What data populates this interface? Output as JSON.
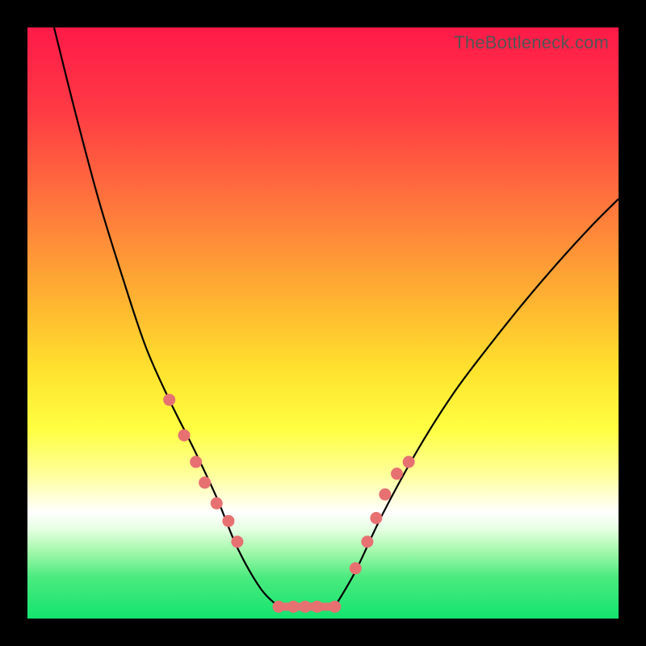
{
  "watermark": "TheBottleneck.com",
  "colors": {
    "marker": "#e77171",
    "curve": "#000000",
    "frame": "#000000"
  },
  "chart_data": {
    "type": "line",
    "title": "",
    "xlabel": "",
    "ylabel": "",
    "xlim": [
      0,
      1
    ],
    "ylim": [
      0,
      1
    ],
    "series": [
      {
        "name": "left-branch",
        "x": [
          0.045,
          0.08,
          0.12,
          0.16,
          0.2,
          0.24,
          0.28,
          0.32,
          0.355,
          0.395,
          0.425
        ],
        "y": [
          1.0,
          0.86,
          0.71,
          0.58,
          0.46,
          0.37,
          0.29,
          0.205,
          0.12,
          0.05,
          0.02
        ]
      },
      {
        "name": "flat-min",
        "x": [
          0.425,
          0.52
        ],
        "y": [
          0.02,
          0.02
        ]
      },
      {
        "name": "right-branch",
        "x": [
          0.52,
          0.555,
          0.6,
          0.66,
          0.72,
          0.78,
          0.84,
          0.9,
          0.955,
          1.0
        ],
        "y": [
          0.02,
          0.08,
          0.175,
          0.285,
          0.38,
          0.46,
          0.535,
          0.605,
          0.665,
          0.71
        ]
      }
    ],
    "markers": {
      "name": "data-points",
      "x": [
        0.24,
        0.265,
        0.285,
        0.3,
        0.32,
        0.34,
        0.355,
        0.425,
        0.45,
        0.47,
        0.49,
        0.52,
        0.555,
        0.575,
        0.59,
        0.605,
        0.625,
        0.645
      ],
      "y": [
        0.37,
        0.31,
        0.265,
        0.23,
        0.195,
        0.165,
        0.13,
        0.02,
        0.02,
        0.02,
        0.02,
        0.02,
        0.085,
        0.13,
        0.17,
        0.21,
        0.245,
        0.265
      ],
      "r": 7
    }
  }
}
